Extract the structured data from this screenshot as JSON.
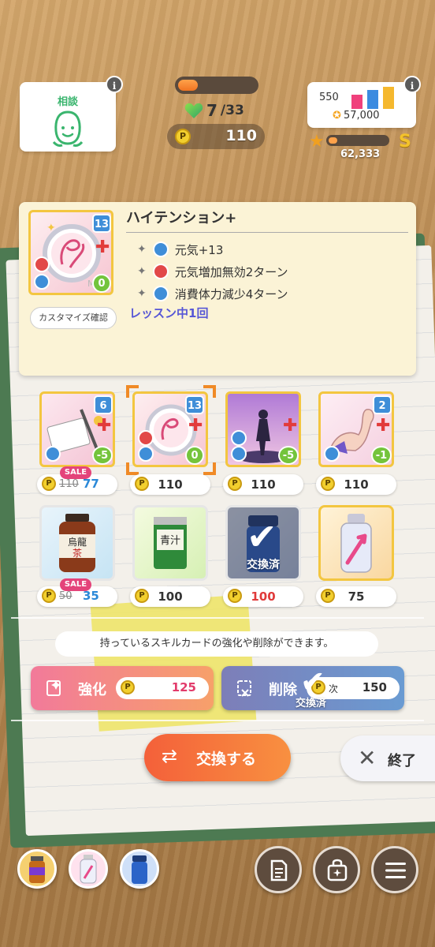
{
  "consult": {
    "label": "相談",
    "info": "i"
  },
  "status": {
    "hp_fraction": 0.25,
    "stamina": "7",
    "stamina_max": "/33",
    "p_icon": "P",
    "p_points": "110"
  },
  "stats": {
    "value_a": "550",
    "value_b": "57,000",
    "rank_points": "62,333",
    "rank_letter": "S",
    "rank_fill_fraction": 0.15,
    "info": "i"
  },
  "detail": {
    "cost": "13",
    "zero": "0",
    "customize_label": "カスタマイズ確認",
    "title": "ハイテンション+",
    "effects": [
      "元気+13",
      "元気増加無効2ターン",
      "消費体力減少4ターン"
    ],
    "lesson_note": "レッスン中1回"
  },
  "cards": [
    {
      "cost": "6",
      "modifier": "-5",
      "sale": "SALE",
      "old_price": "110",
      "new_price": "77"
    },
    {
      "cost": "13",
      "modifier": "0",
      "price": "110",
      "selected": true
    },
    {
      "cost": "",
      "modifier": "-5",
      "price": "110"
    },
    {
      "cost": "2",
      "modifier": "-1",
      "price": "110"
    }
  ],
  "items": [
    {
      "name": "烏龍茶",
      "sale": "SALE",
      "old_price": "50",
      "new_price": "35"
    },
    {
      "name": "青汁",
      "price": "100"
    },
    {
      "name": "blue-bottle",
      "price": "100",
      "exchanged_label": "交換済"
    },
    {
      "name": "pink-bottle",
      "price": "75"
    }
  ],
  "info_message": "持っているスキルカードの強化や削除ができます。",
  "enhance": {
    "label": "強化",
    "price": "125"
  },
  "delete": {
    "label": "削除",
    "next_label": "次",
    "price": "150",
    "exchanged_label": "交換済"
  },
  "exchange_button": "交換する",
  "end_button": "終了",
  "colors": {
    "accent_orange": "#f4603a",
    "enhance_pink": "#f27a9a",
    "delete_blue": "#7d7eb8",
    "card_gold": "#f3c640",
    "highlight_orange": "#f08a26"
  }
}
